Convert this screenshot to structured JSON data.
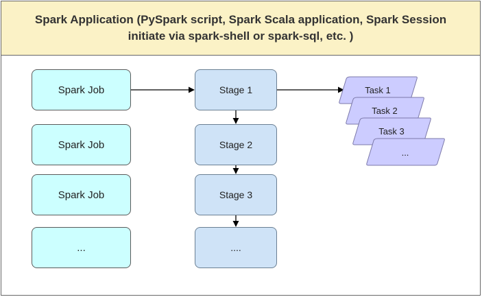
{
  "header": {
    "title": "Spark Application (PySpark script, Spark Scala application, Spark Session\ninitiate via spark-shell or spark-sql, etc. )"
  },
  "jobs": [
    {
      "label": "Spark Job"
    },
    {
      "label": "Spark Job"
    },
    {
      "label": "Spark Job"
    },
    {
      "label": "..."
    }
  ],
  "stages": [
    {
      "label": "Stage 1"
    },
    {
      "label": "Stage 2"
    },
    {
      "label": "Stage 3"
    },
    {
      "label": "...."
    }
  ],
  "tasks": [
    {
      "label": "Task 1"
    },
    {
      "label": "Task 2"
    },
    {
      "label": "Task 3"
    },
    {
      "label": "..."
    }
  ],
  "colors": {
    "header_fill": "#fbf2c6",
    "job_fill": "#ccffff",
    "stage_fill": "#cfe3f7",
    "task_fill": "#ccccff",
    "task_stroke": "#7b78a8",
    "arrow": "#000000"
  }
}
